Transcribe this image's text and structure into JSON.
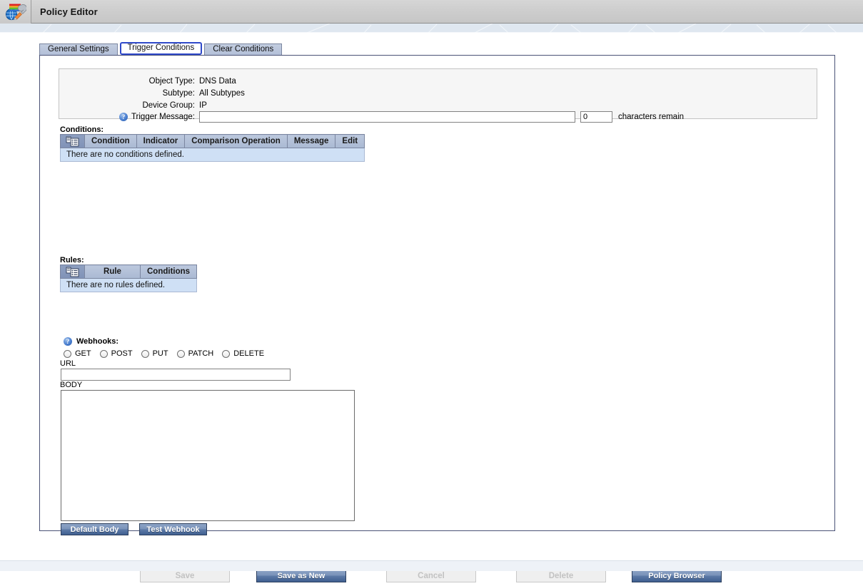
{
  "window": {
    "title": "Policy Editor",
    "app_icon": "policy-editor-icon"
  },
  "tabs": [
    {
      "id": "general-settings",
      "label": "General Settings",
      "active": false
    },
    {
      "id": "trigger-conditions",
      "label": "Trigger Conditions",
      "active": true
    },
    {
      "id": "clear-conditions",
      "label": "Clear Conditions",
      "active": false
    }
  ],
  "info": {
    "object_type_label": "Object Type:",
    "object_type_value": "DNS Data",
    "subtype_label": "Subtype:",
    "subtype_value": "All Subtypes",
    "device_group_label": "Device Group:",
    "device_group_value": "IP",
    "trigger_message_label": "Trigger Message:",
    "trigger_message_value": "",
    "trigger_message_placeholder": "",
    "chars_remain_value": "0",
    "chars_remain_label": "characters remain",
    "help_icon": "help-circle-icon"
  },
  "conditions": {
    "section_label": "Conditions:",
    "add_icon": "new-row-icon",
    "columns": [
      "Condition",
      "Indicator",
      "Comparison Operation",
      "Message",
      "Edit"
    ],
    "rows": [],
    "empty_text": "There are no conditions defined."
  },
  "rules": {
    "section_label": "Rules:",
    "add_icon": "new-row-icon",
    "columns": [
      "Rule",
      "Conditions"
    ],
    "rows": [],
    "empty_text": "There are no rules defined."
  },
  "webhooks": {
    "section_label": "Webhooks:",
    "help_icon": "help-circle-icon",
    "methods": [
      {
        "id": "get",
        "label": "GET",
        "selected": false
      },
      {
        "id": "post",
        "label": "POST",
        "selected": false
      },
      {
        "id": "put",
        "label": "PUT",
        "selected": false
      },
      {
        "id": "patch",
        "label": "PATCH",
        "selected": false
      },
      {
        "id": "delete",
        "label": "DELETE",
        "selected": false
      }
    ],
    "url_label": "URL",
    "url_value": "",
    "body_label": "BODY",
    "body_value": "",
    "default_body_button": "Default Body",
    "test_webhook_button": "Test Webhook"
  },
  "footer": {
    "save_label": "Save",
    "save_enabled": false,
    "save_as_new_label": "Save as New",
    "save_as_new_enabled": true,
    "cancel_label": "Cancel",
    "cancel_enabled": false,
    "delete_label": "Delete",
    "delete_enabled": false,
    "policy_browser_label": "Policy Browser",
    "policy_browser_enabled": true
  },
  "colors": {
    "titlebar": "#cdcdcd",
    "tab_inactive": "#b3c0d8",
    "tab_active_outline": "#2f49c9",
    "panel_border": "#4a5276",
    "grid_header": "#aab9d3",
    "grid_empty_row": "#cfe0f5",
    "button_blue": "#3f5f90",
    "button_disabled_text": "#c2c2c2",
    "band_blue": "#dfe7f0"
  }
}
